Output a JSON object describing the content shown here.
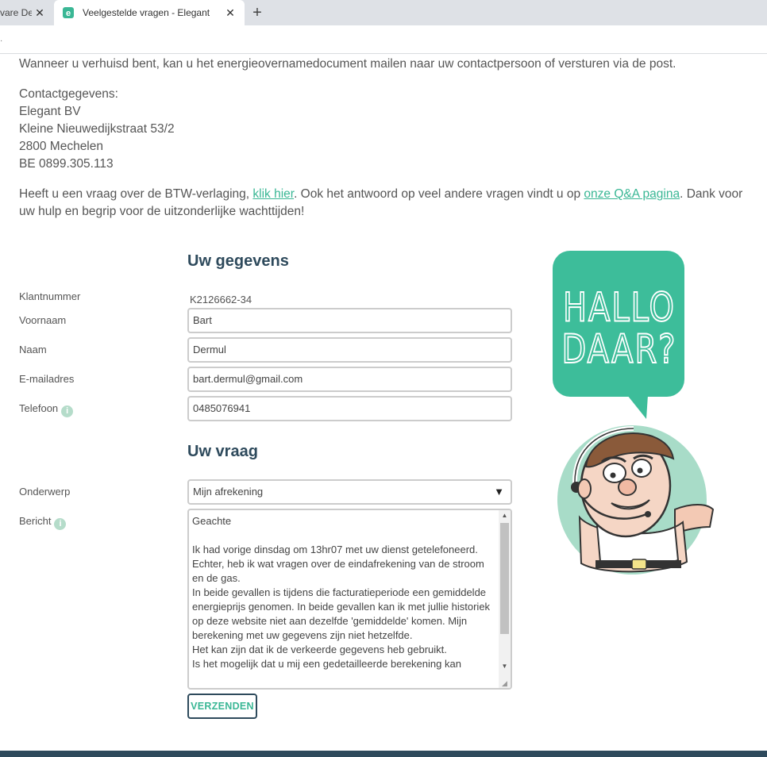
{
  "browser": {
    "prev_tab_title": "vare De",
    "active_tab_title": "Veelgestelde vragen - Elegant",
    "close_glyph": "✕",
    "new_tab_glyph": "+"
  },
  "page": {
    "intro": "Wanneer u verhuisd bent, kan u het energieovernamedocument mailen naar uw contactpersoon of versturen via de post.",
    "contact": {
      "heading": "Contactgegevens:",
      "company": "Elegant BV",
      "street": "Kleine Nieuwedijkstraat 53/2",
      "city": "2800 Mechelen",
      "vat": "BE 0899.305.113"
    },
    "btw": {
      "before_link1": "Heeft u een vraag over de BTW-verlaging, ",
      "link1": "klik hier",
      "between": ". Ook het antwoord op veel andere vragen vindt u op ",
      "link2": "onze Q&A pagina",
      "after": ". Dank voor uw hulp en begrip voor de uitzonderlijke wachttijden!"
    }
  },
  "form": {
    "section1_title": "Uw gegevens",
    "section2_title": "Uw vraag",
    "labels": {
      "klantnummer": "Klantnummer",
      "voornaam": "Voornaam",
      "naam": "Naam",
      "email": "E-mailadres",
      "telefoon": "Telefoon",
      "onderwerp": "Onderwerp",
      "bericht": "Bericht"
    },
    "values": {
      "klantnummer": "K2126662-34",
      "voornaam": "Bart",
      "naam": "Dermul",
      "email": "bart.dermul@gmail.com",
      "telefoon": "0485076941",
      "onderwerp": "Mijn afrekening",
      "bericht": "Geachte\n\nIk had vorige dinsdag om 13hr07 met uw dienst getelefoneerd. Echter, heb ik wat vragen over de eindafrekening van de stroom en de gas.\nIn beide gevallen is tijdens die facturatieperiode een gemiddelde energieprijs genomen. In beide gevallen kan ik met jullie historiek op deze website niet aan dezelfde 'gemiddelde' komen. Mijn berekening met uw gegevens zijn niet hetzelfde.\nHet kan zijn dat ik de verkeerde gegevens heb gebruikt.\nIs het mogelijk dat u mij een gedetailleerde berekening kan"
    },
    "info_glyph": "i",
    "select_arrow": "▼",
    "submit_label": "VERZENDEN"
  },
  "mascot": {
    "bubble_line1": "HALLO",
    "bubble_line2": "DAAR?"
  },
  "colors": {
    "accent": "#3ab795",
    "heading": "#2e4a5c",
    "bubble": "#3dbd9a",
    "avatar_bg": "#a8dcc8"
  }
}
